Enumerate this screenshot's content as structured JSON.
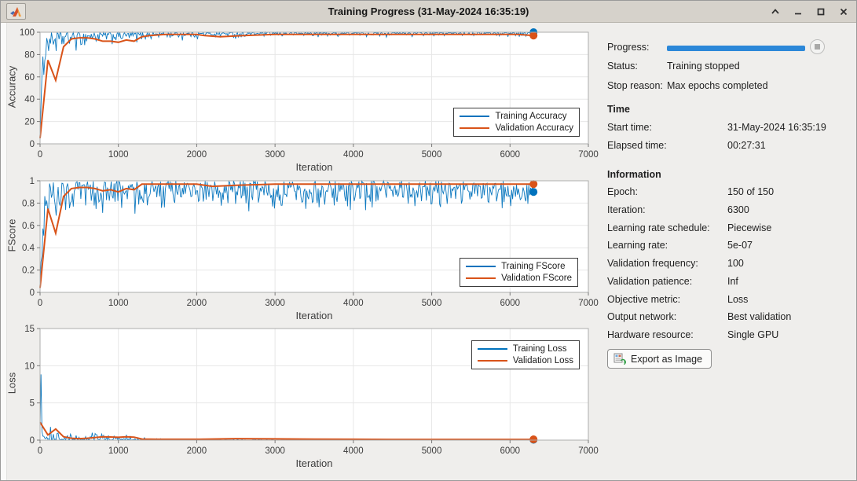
{
  "window": {
    "title": "Training Progress (31-May-2024 16:35:19)"
  },
  "panel": {
    "progress_label": "Progress:",
    "progress_percent": 100,
    "progress_color": "#2b87d8",
    "status_label": "Status:",
    "status_value": "Training stopped",
    "stop_reason_label": "Stop reason:",
    "stop_reason_value": "Max epochs completed",
    "time_header": "Time",
    "time_rows": [
      {
        "label": "Start time:",
        "value": "31-May-2024 16:35:19"
      },
      {
        "label": "Elapsed time:",
        "value": "00:27:31"
      }
    ],
    "info_header": "Information",
    "info_rows": [
      {
        "label": "Epoch:",
        "value": "150 of 150"
      },
      {
        "label": "Iteration:",
        "value": "6300"
      },
      {
        "label": "Learning rate schedule:",
        "value": "Piecewise"
      },
      {
        "label": "Learning rate:",
        "value": "5e-07"
      },
      {
        "label": "Validation frequency:",
        "value": "100"
      },
      {
        "label": "Validation patience:",
        "value": "Inf"
      },
      {
        "label": "Objective metric:",
        "value": "Loss"
      },
      {
        "label": "Output network:",
        "value": "Best validation"
      },
      {
        "label": "Hardware resource:",
        "value": "Single GPU"
      }
    ],
    "export_button_label": "Export as Image"
  },
  "chart_data": [
    {
      "type": "line",
      "title": "",
      "xlabel": "Iteration",
      "ylabel": "Accuracy",
      "xlim": [
        0,
        7000
      ],
      "ylim": [
        0,
        100
      ],
      "xticks": [
        0,
        1000,
        2000,
        3000,
        4000,
        5000,
        6000,
        7000
      ],
      "yticks": [
        0,
        20,
        40,
        60,
        80,
        100
      ],
      "grid": true,
      "legend": [
        "Training Accuracy",
        "Validation Accuracy"
      ],
      "legend_position": "right-middle",
      "series": [
        {
          "name": "Training Accuracy",
          "color": "#0072BD",
          "style": "noisy-band",
          "bias": 0.25,
          "envelope": [
            [
              0,
              2,
              10
            ],
            [
              30,
              30,
              75
            ],
            [
              60,
              50,
              92
            ],
            [
              100,
              58,
              100
            ],
            [
              150,
              60,
              100
            ],
            [
              200,
              63,
              100
            ],
            [
              250,
              60,
              100
            ],
            [
              300,
              68,
              100
            ],
            [
              400,
              72,
              100
            ],
            [
              500,
              75,
              100
            ],
            [
              600,
              78,
              100
            ],
            [
              700,
              80,
              100
            ],
            [
              800,
              80,
              100
            ],
            [
              900,
              82,
              100
            ],
            [
              1000,
              83,
              100
            ],
            [
              1100,
              82,
              100
            ],
            [
              1200,
              85,
              100
            ],
            [
              1400,
              88,
              100
            ],
            [
              1600,
              90,
              100
            ],
            [
              1800,
              90,
              100
            ],
            [
              2000,
              91,
              100
            ],
            [
              2200,
              92,
              100
            ],
            [
              2500,
              92,
              100
            ],
            [
              2800,
              93,
              100
            ],
            [
              3200,
              93,
              100
            ],
            [
              3600,
              94,
              100
            ],
            [
              4000,
              94,
              100
            ],
            [
              4500,
              94,
              100
            ],
            [
              5000,
              94,
              100
            ],
            [
              5500,
              95,
              100
            ],
            [
              6000,
              94,
              100
            ],
            [
              6300,
              95,
              100
            ]
          ]
        },
        {
          "name": "Validation Accuracy",
          "color": "#D95319",
          "style": "line",
          "points": [
            [
              0,
              5
            ],
            [
              100,
              75
            ],
            [
              200,
              57
            ],
            [
              300,
              87
            ],
            [
              400,
              94
            ],
            [
              500,
              95
            ],
            [
              600,
              95
            ],
            [
              700,
              94
            ],
            [
              800,
              92
            ],
            [
              900,
              92
            ],
            [
              1000,
              91
            ],
            [
              1100,
              93
            ],
            [
              1200,
              92
            ],
            [
              1300,
              96
            ],
            [
              1400,
              97
            ],
            [
              1600,
              98
            ],
            [
              1800,
              98
            ],
            [
              2000,
              98
            ],
            [
              2100,
              97
            ],
            [
              2300,
              96
            ],
            [
              2600,
              97
            ],
            [
              3000,
              98
            ],
            [
              3400,
              98
            ],
            [
              3800,
              98
            ],
            [
              4200,
              98
            ],
            [
              4600,
              98
            ],
            [
              5000,
              98
            ],
            [
              5400,
              98
            ],
            [
              5800,
              98
            ],
            [
              6100,
              98
            ],
            [
              6300,
              97
            ]
          ]
        }
      ],
      "end_markers": [
        {
          "x": 6300,
          "y": 100,
          "color": "#0072BD"
        },
        {
          "x": 6300,
          "y": 97,
          "color": "#D95319"
        }
      ]
    },
    {
      "type": "line",
      "title": "",
      "xlabel": "Iteration",
      "ylabel": "FScore",
      "xlim": [
        0,
        7000
      ],
      "ylim": [
        0,
        1
      ],
      "xticks": [
        0,
        1000,
        2000,
        3000,
        4000,
        5000,
        6000,
        7000
      ],
      "yticks": [
        0,
        0.2,
        0.4,
        0.6,
        0.8,
        1
      ],
      "grid": true,
      "legend": [
        "Training FScore",
        "Validation FScore"
      ],
      "legend_position": "right-bottom",
      "series": [
        {
          "name": "Training FScore",
          "color": "#0072BD",
          "style": "noisy-band",
          "bias": 0.45,
          "envelope": [
            [
              0,
              0.01,
              0.08
            ],
            [
              30,
              0.25,
              0.65
            ],
            [
              60,
              0.45,
              0.9
            ],
            [
              100,
              0.55,
              1
            ],
            [
              200,
              0.58,
              1
            ],
            [
              300,
              0.6,
              1
            ],
            [
              400,
              0.63,
              1
            ],
            [
              600,
              0.65,
              1
            ],
            [
              800,
              0.64,
              1
            ],
            [
              1000,
              0.66,
              1
            ],
            [
              1200,
              0.68,
              1
            ],
            [
              1500,
              0.7,
              1
            ],
            [
              2000,
              0.7,
              1
            ],
            [
              2500,
              0.68,
              1
            ],
            [
              3000,
              0.7,
              1
            ],
            [
              3500,
              0.68,
              1
            ],
            [
              4000,
              0.7,
              1
            ],
            [
              4500,
              0.7,
              1
            ],
            [
              5000,
              0.7,
              1
            ],
            [
              5500,
              0.72,
              1
            ],
            [
              6000,
              0.7,
              1
            ],
            [
              6300,
              0.72,
              1
            ]
          ]
        },
        {
          "name": "Validation FScore",
          "color": "#D95319",
          "style": "line",
          "points": [
            [
              0,
              0.04
            ],
            [
              100,
              0.75
            ],
            [
              200,
              0.53
            ],
            [
              300,
              0.86
            ],
            [
              400,
              0.93
            ],
            [
              500,
              0.94
            ],
            [
              600,
              0.94
            ],
            [
              700,
              0.93
            ],
            [
              800,
              0.91
            ],
            [
              900,
              0.92
            ],
            [
              1000,
              0.9
            ],
            [
              1100,
              0.93
            ],
            [
              1200,
              0.92
            ],
            [
              1300,
              0.97
            ],
            [
              1500,
              0.97
            ],
            [
              1800,
              0.97
            ],
            [
              2000,
              0.97
            ],
            [
              2200,
              0.95
            ],
            [
              2500,
              0.96
            ],
            [
              3000,
              0.97
            ],
            [
              3500,
              0.97
            ],
            [
              4000,
              0.97
            ],
            [
              4500,
              0.97
            ],
            [
              5000,
              0.97
            ],
            [
              5500,
              0.97
            ],
            [
              6000,
              0.97
            ],
            [
              6300,
              0.97
            ]
          ]
        }
      ],
      "end_markers": [
        {
          "x": 6300,
          "y": 0.9,
          "color": "#0072BD"
        },
        {
          "x": 6300,
          "y": 0.97,
          "color": "#D95319"
        }
      ]
    },
    {
      "type": "line",
      "title": "",
      "xlabel": "Iteration",
      "ylabel": "Loss",
      "xlim": [
        0,
        7000
      ],
      "ylim": [
        0,
        15
      ],
      "xticks": [
        0,
        1000,
        2000,
        3000,
        4000,
        5000,
        6000,
        7000
      ],
      "yticks": [
        0,
        5,
        10,
        15
      ],
      "grid": true,
      "legend": [
        "Training Loss",
        "Validation Loss"
      ],
      "legend_position": "right-top",
      "series": [
        {
          "name": "Training Loss",
          "color": "#0072BD",
          "style": "noisy-band",
          "bias": 4,
          "envelope": [
            [
              0,
              1.5,
              15
            ],
            [
              40,
              0.4,
              7
            ],
            [
              80,
              0.15,
              3.5
            ],
            [
              150,
              0.1,
              2
            ],
            [
              250,
              0.05,
              1.2
            ],
            [
              350,
              0.04,
              0.9
            ],
            [
              500,
              0.04,
              1
            ],
            [
              650,
              0.04,
              1.3
            ],
            [
              800,
              0.03,
              0.9
            ],
            [
              950,
              0.03,
              0.8
            ],
            [
              1100,
              0.03,
              1
            ],
            [
              1250,
              0.02,
              0.6
            ],
            [
              1400,
              0.02,
              0.25
            ],
            [
              1700,
              0.01,
              0.15
            ],
            [
              2000,
              0.01,
              0.12
            ],
            [
              2500,
              0.01,
              0.1
            ],
            [
              3000,
              0.01,
              0.1
            ],
            [
              4000,
              0.01,
              0.08
            ],
            [
              5000,
              0.01,
              0.08
            ],
            [
              6000,
              0.01,
              0.08
            ],
            [
              6300,
              0.01,
              0.08
            ]
          ]
        },
        {
          "name": "Validation Loss",
          "color": "#D95319",
          "style": "line",
          "points": [
            [
              0,
              2.4
            ],
            [
              100,
              0.7
            ],
            [
              200,
              1.5
            ],
            [
              300,
              0.45
            ],
            [
              400,
              0.25
            ],
            [
              500,
              0.2
            ],
            [
              600,
              0.25
            ],
            [
              700,
              0.35
            ],
            [
              800,
              0.45
            ],
            [
              900,
              0.42
            ],
            [
              1000,
              0.38
            ],
            [
              1100,
              0.45
            ],
            [
              1200,
              0.4
            ],
            [
              1300,
              0.15
            ],
            [
              1500,
              0.12
            ],
            [
              2000,
              0.12
            ],
            [
              2500,
              0.2
            ],
            [
              3000,
              0.17
            ],
            [
              3500,
              0.13
            ],
            [
              4000,
              0.12
            ],
            [
              4500,
              0.1
            ],
            [
              5000,
              0.1
            ],
            [
              5500,
              0.1
            ],
            [
              6000,
              0.1
            ],
            [
              6300,
              0.1
            ]
          ]
        }
      ],
      "end_markers": [
        {
          "x": 6300,
          "y": 0.05,
          "color": "#0072BD"
        },
        {
          "x": 6300,
          "y": 0.1,
          "color": "#D95319"
        }
      ]
    }
  ]
}
